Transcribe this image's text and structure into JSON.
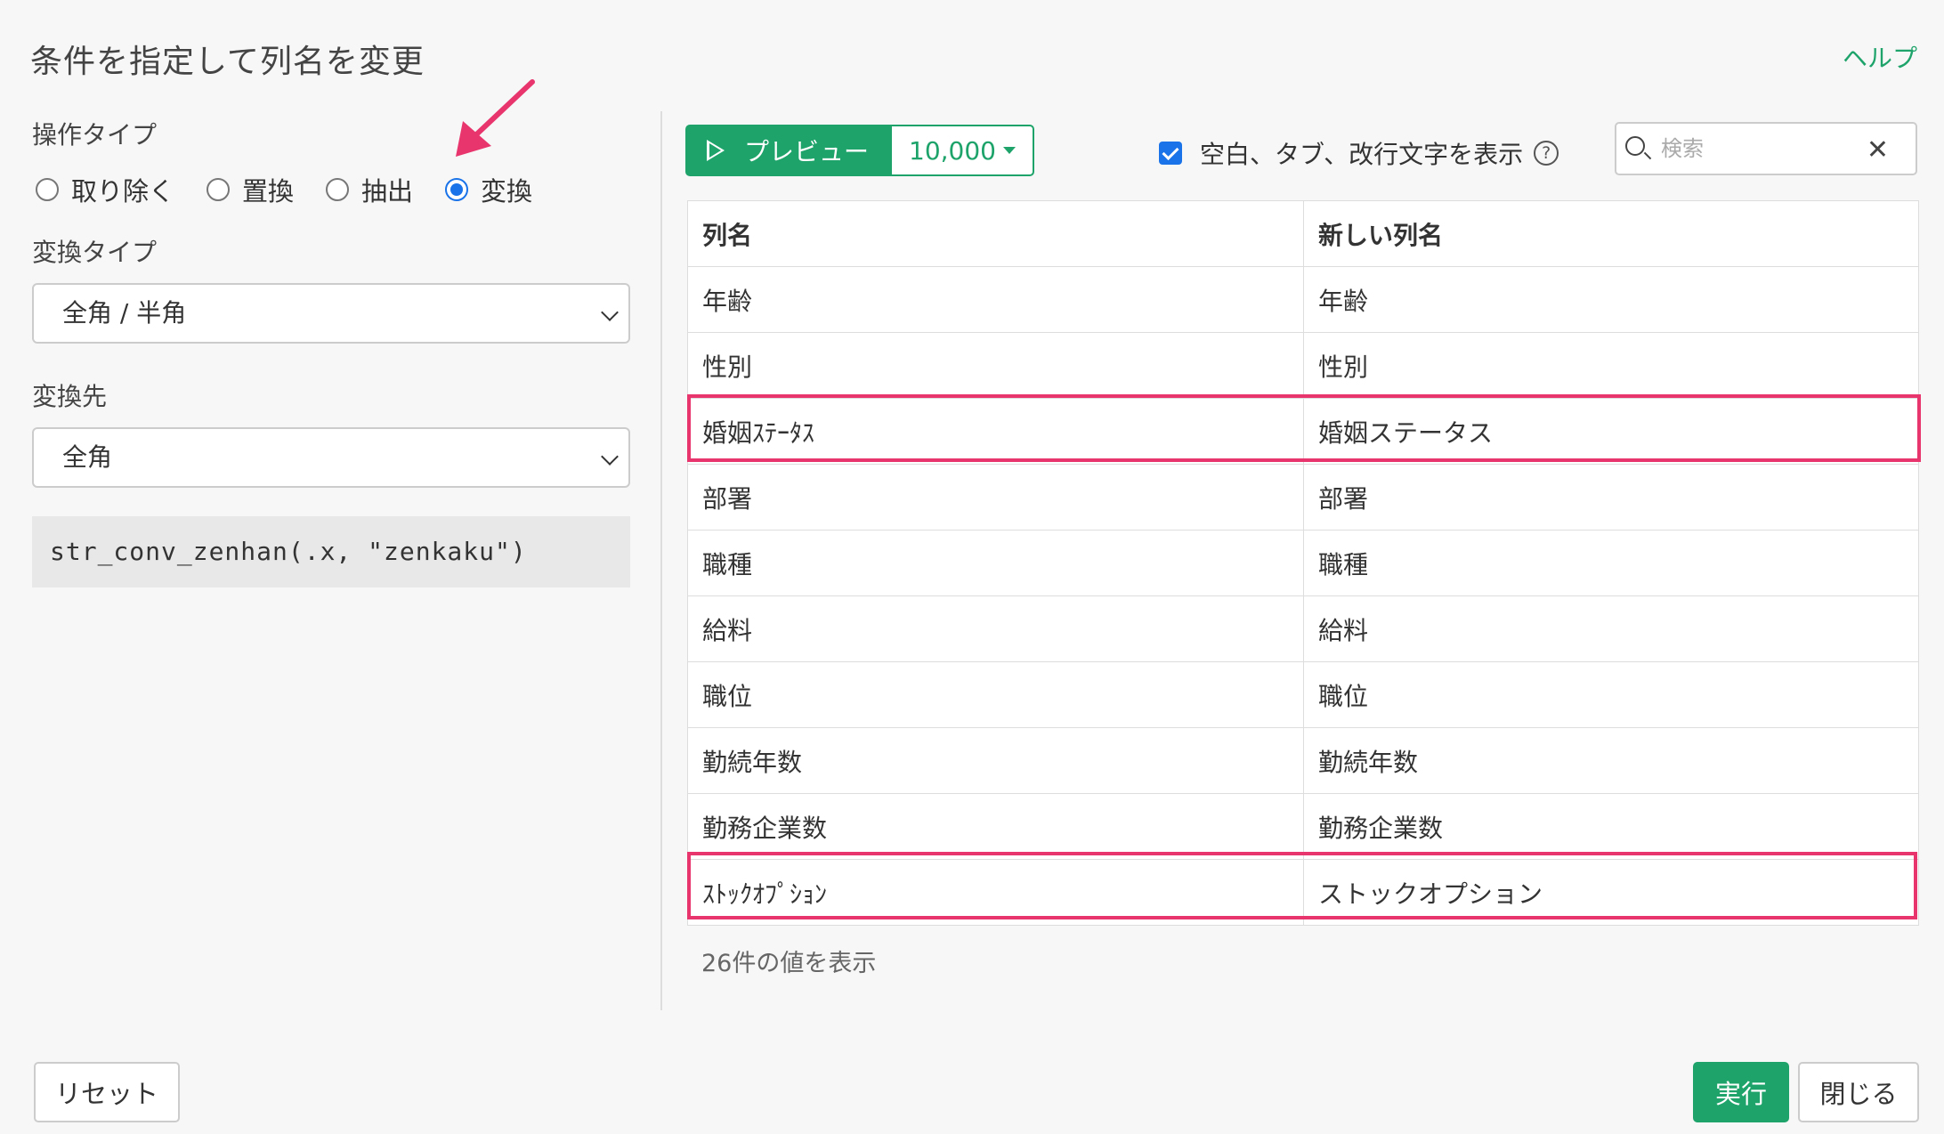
{
  "dialog": {
    "title": "条件を指定して列名を変更",
    "help": "ヘルプ"
  },
  "left": {
    "op_type_label": "操作タイプ",
    "op_types": [
      {
        "label": "取り除く",
        "selected": false
      },
      {
        "label": "置換",
        "selected": false
      },
      {
        "label": "抽出",
        "selected": false
      },
      {
        "label": "変換",
        "selected": true
      }
    ],
    "conv_type_label": "変換タイプ",
    "conv_type_value": "全角 / 半角",
    "conv_target_label": "変換先",
    "conv_target_value": "全角",
    "code": "str_conv_zenhan(.x, \"zenkaku\")"
  },
  "toolbar": {
    "preview_label": "プレビュー",
    "rows_value": "10,000",
    "show_whitespace_label": "空白、タブ、改行文字を表示",
    "show_whitespace_checked": true,
    "help_icon_glyph": "?",
    "close_glyph": "✕",
    "search_placeholder": "検索"
  },
  "table": {
    "headers": [
      "列名",
      "新しい列名"
    ],
    "rows": [
      [
        "年齢",
        "年齢"
      ],
      [
        "性別",
        "性別"
      ],
      [
        "婚姻ｽﾃｰﾀｽ",
        "婚姻ステータス"
      ],
      [
        "部署",
        "部署"
      ],
      [
        "職種",
        "職種"
      ],
      [
        "給料",
        "給料"
      ],
      [
        "職位",
        "職位"
      ],
      [
        "勤続年数",
        "勤続年数"
      ],
      [
        "勤務企業数",
        "勤務企業数"
      ],
      [
        "ｽﾄｯｸｵﾌﾟｼｮﾝ",
        "ストックオプション"
      ]
    ],
    "highlighted_rows": [
      2,
      9
    ],
    "footer": "26件の値を表示"
  },
  "footer": {
    "reset": "リセット",
    "run": "実行",
    "close": "閉じる"
  },
  "colors": {
    "accent": "#1ea36b",
    "highlight": "#e8356d",
    "radio": "#1a73e8"
  }
}
